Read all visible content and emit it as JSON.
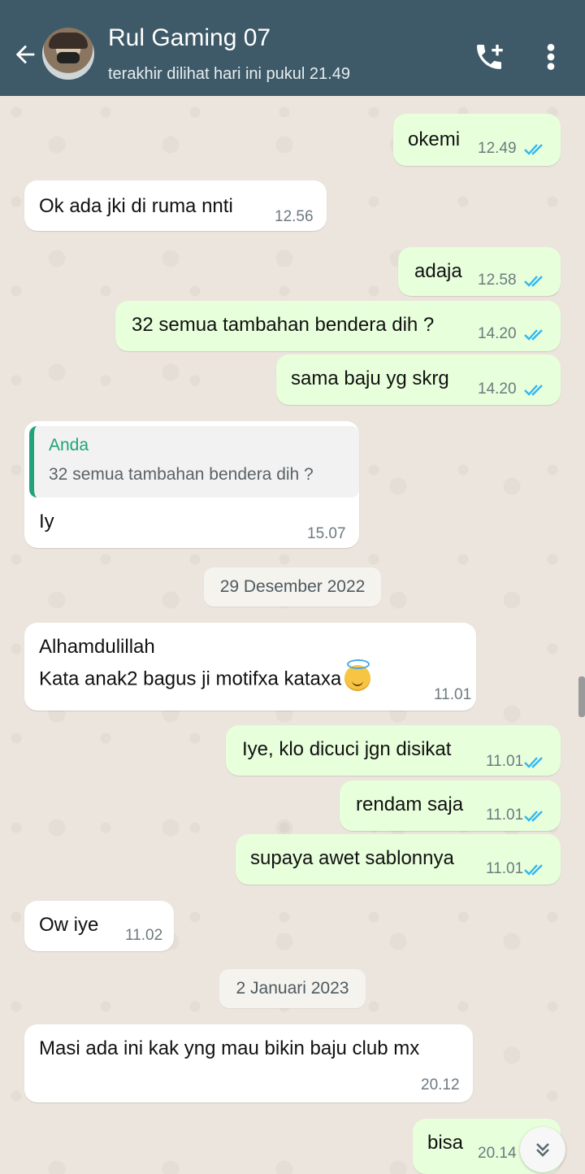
{
  "header": {
    "contact_name": "Rul Gaming 07",
    "last_seen": "terakhir dilihat hari ini pukul 21.49",
    "icons": [
      "back-arrow-icon",
      "avatar",
      "add-call-icon",
      "more-vert-icon"
    ]
  },
  "colors": {
    "header": "#3e5a68",
    "wallpaper": "#ece5dd",
    "incoming": "#ffffff",
    "outgoing": "#e7ffdb",
    "read_ticks": "#34b7f1",
    "quote_accent": "#1fa37a"
  },
  "messages": [
    {
      "dir": "out",
      "text": "okemi",
      "time": "12.49",
      "read": true
    },
    {
      "dir": "in",
      "text": "Ok ada jki di ruma nnti",
      "time": "12.56"
    },
    {
      "dir": "out",
      "text": "adaja",
      "time": "12.58",
      "read": true
    },
    {
      "dir": "out",
      "text": "32 semua tambahan bendera dih ?",
      "time": "14.20",
      "read": true
    },
    {
      "dir": "out",
      "text": "sama baju yg skrg",
      "time": "14.20",
      "read": true
    },
    {
      "dir": "in",
      "quote_author": "Anda",
      "quote_text": "32 semua tambahan bendera dih ?",
      "text": "Iy",
      "time": "15.07"
    },
    {
      "date": "29 Desember 2022"
    },
    {
      "dir": "in",
      "line1": "Alhamdulillah",
      "line2": "Kata anak2 bagus ji motifxa kataxa",
      "emoji": "smiling-face-with-halo",
      "time": "11.01"
    },
    {
      "dir": "out",
      "text": "Iye, klo dicuci jgn disikat",
      "time": "11.01",
      "read": true
    },
    {
      "dir": "out",
      "text": "rendam saja",
      "time": "11.01",
      "read": true
    },
    {
      "dir": "out",
      "text": "supaya awet sablonnya",
      "time": "11.01",
      "read": true
    },
    {
      "dir": "in",
      "text": "Ow iye",
      "time": "11.02"
    },
    {
      "date": "2 Januari 2023"
    },
    {
      "dir": "in",
      "text": "Masi ada ini kak yng mau bikin baju club mx",
      "time": "20.12"
    },
    {
      "dir": "out",
      "text": "bisa",
      "time": "20.14",
      "read": true
    }
  ]
}
